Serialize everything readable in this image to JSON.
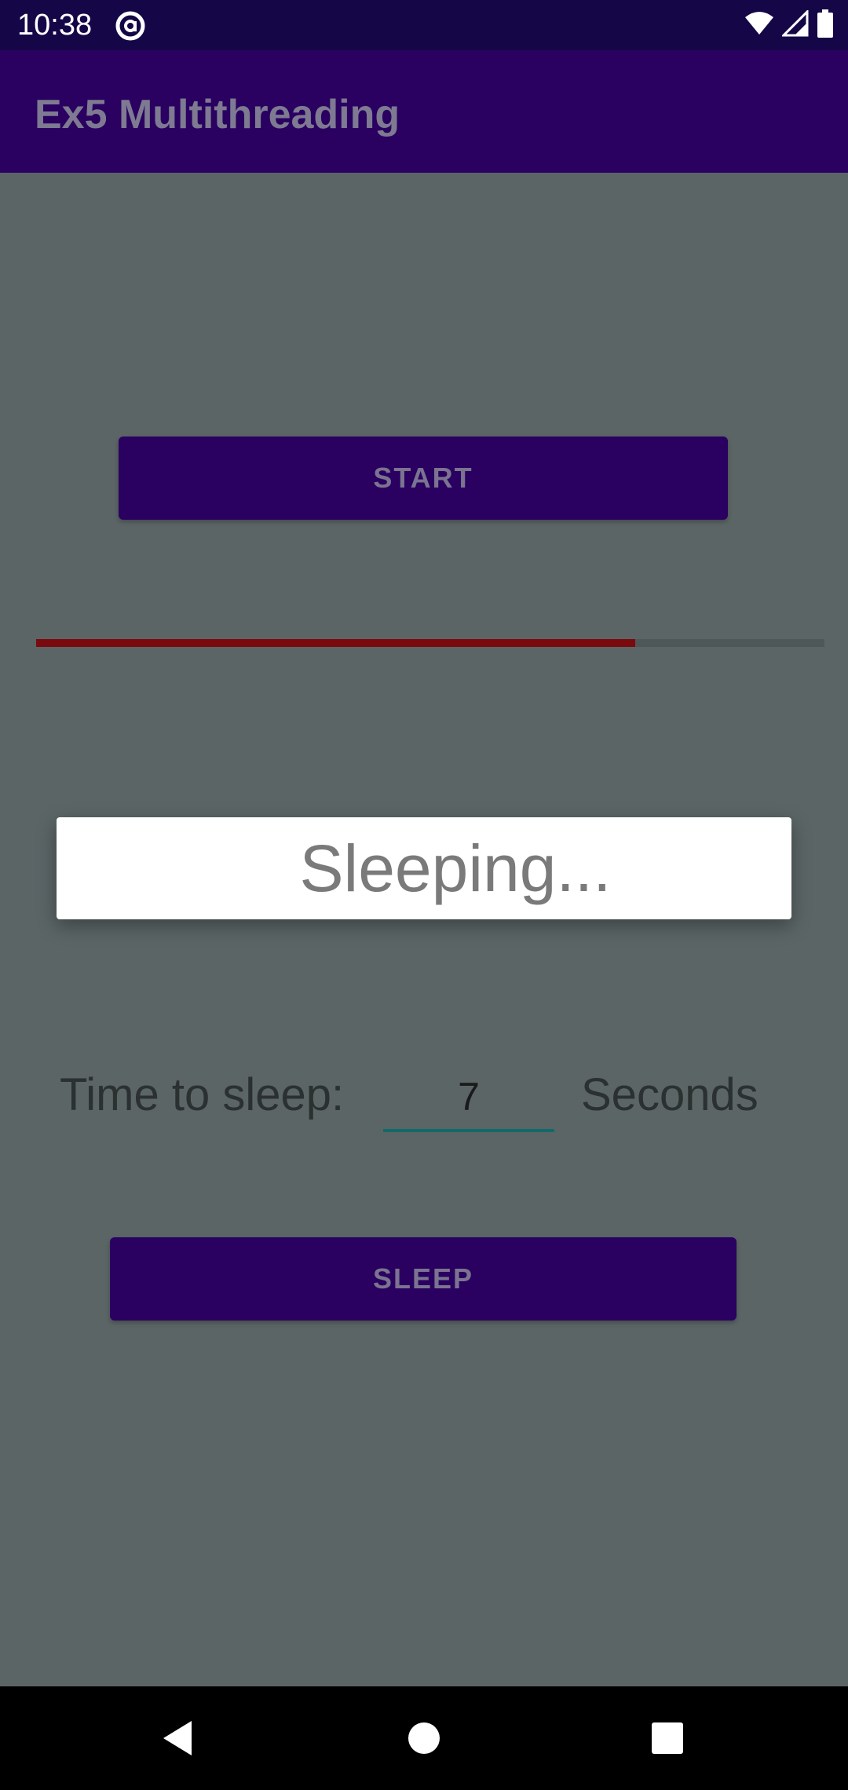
{
  "status_bar": {
    "time": "10:38",
    "icons": [
      "notification-at-icon",
      "wifi-icon",
      "cell-signal-icon",
      "battery-icon"
    ]
  },
  "app_bar": {
    "title": "Ex5 Multithreading"
  },
  "start_button": {
    "label": "START"
  },
  "progress": {
    "value_fraction": 0.76,
    "fill_color": "#7a0a0e",
    "track_color": "#4f5858"
  },
  "dialog": {
    "message": "Sleeping..."
  },
  "sleep_row": {
    "label": "Time to sleep:",
    "value": "7",
    "unit": "Seconds"
  },
  "sleep_button": {
    "label": "SLEEP"
  },
  "nav_bar": {
    "icons": [
      "back-icon",
      "home-icon",
      "recents-icon"
    ]
  },
  "colors": {
    "primary": "#2a0061",
    "status_bar": "#150747",
    "scrim_background": "#5b6566",
    "input_underline": "#116a6a"
  }
}
